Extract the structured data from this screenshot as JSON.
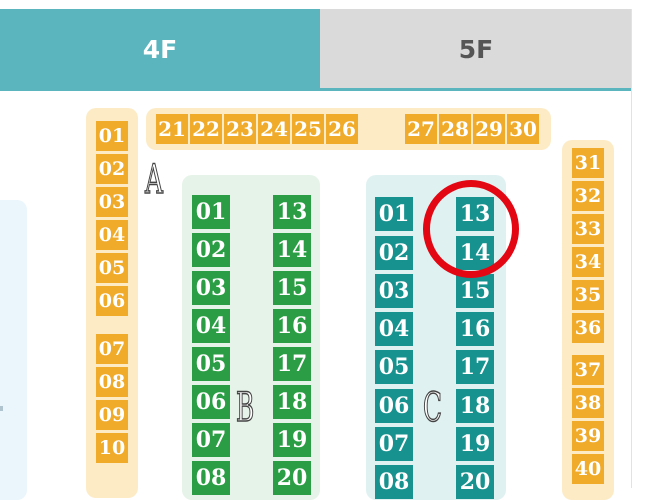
{
  "tabs": [
    {
      "label": "4F",
      "active": true
    },
    {
      "label": "5F",
      "active": false
    }
  ],
  "sections": {
    "a": "A",
    "b": "B",
    "c": "C"
  },
  "colors": {
    "accent_teal": "#5ab5bf",
    "yellow_booth": "#f0ab2b",
    "green_booth": "#2b9e45",
    "teal_booth": "#17928f",
    "highlight": "#e30613"
  },
  "booths": {
    "a_left": [
      "01",
      "02",
      "03",
      "04",
      "05",
      "06",
      "07",
      "08",
      "09",
      "10"
    ],
    "a_top": [
      "21",
      "22",
      "23",
      "24",
      "25",
      "26",
      "27",
      "28",
      "29",
      "30"
    ],
    "a_right": [
      "31",
      "32",
      "33",
      "34",
      "35",
      "36",
      "37",
      "38",
      "39",
      "40"
    ],
    "b_left": [
      "01",
      "02",
      "03",
      "04",
      "05",
      "06",
      "07",
      "08"
    ],
    "b_right": [
      "13",
      "14",
      "15",
      "16",
      "17",
      "18",
      "19",
      "20"
    ],
    "c_left": [
      "01",
      "02",
      "03",
      "04",
      "05",
      "06",
      "07",
      "08"
    ],
    "c_right": [
      "13",
      "14",
      "15",
      "16",
      "17",
      "18",
      "19",
      "20"
    ]
  },
  "highlighted": {
    "section": "C",
    "booths": [
      "13",
      "14"
    ]
  }
}
